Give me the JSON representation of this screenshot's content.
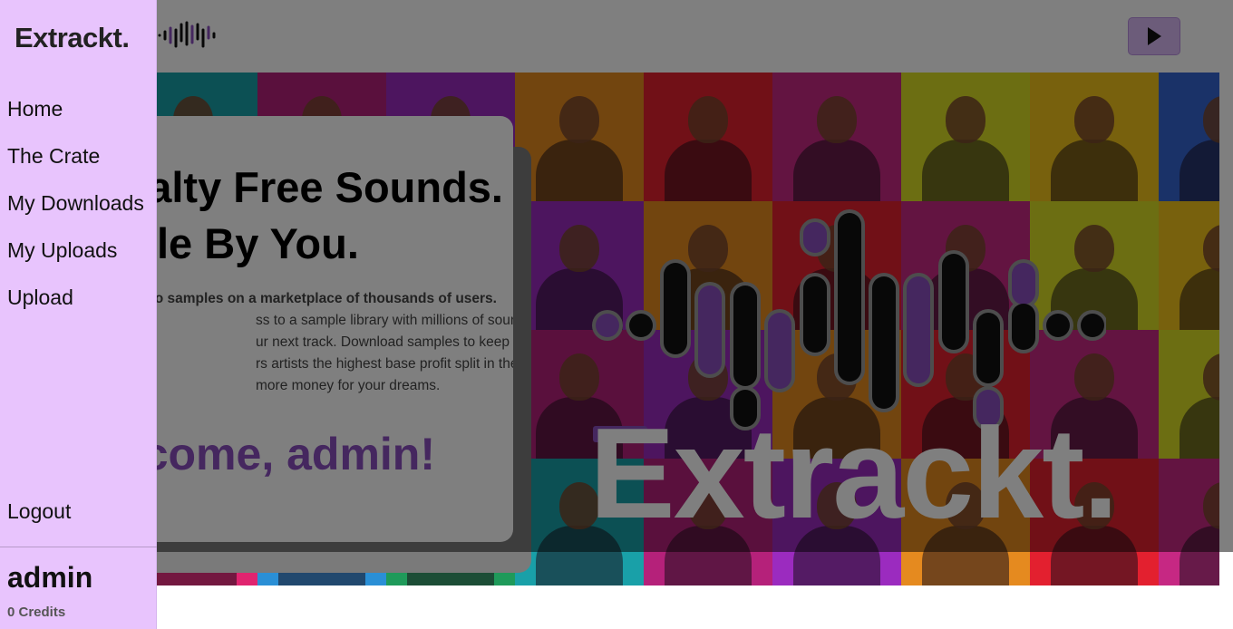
{
  "app": {
    "logo": "Extrackt."
  },
  "sidebar": {
    "items": [
      {
        "label": "Home"
      },
      {
        "label": "The Crate"
      },
      {
        "label": "My Downloads"
      },
      {
        "label": "My Uploads"
      },
      {
        "label": "Upload"
      }
    ],
    "logout_label": "Logout",
    "user": {
      "name": "admin",
      "credits": "0 Credits"
    }
  },
  "header": {
    "play_icon": "play-icon"
  },
  "card": {
    "headline_line1": "alty Free Sounds.",
    "headline_line2": "le By You.",
    "body_lines": [
      "dio samples on a marketplace of thousands of users.",
      "ss to a sample library with millions of sounds, ready",
      "ur next track. Download samples to keep forever.",
      "rs artists the highest base profit split in the industry.",
      "more money for your dreams."
    ],
    "welcome": "lcome, admin!"
  },
  "hero": {
    "wordmark": "Extrackt."
  },
  "colors": {
    "drawer_bg": "#e8c4fd",
    "accent": "#8a4fbf",
    "overlay": "rgba(0,0,0,0.5)"
  }
}
